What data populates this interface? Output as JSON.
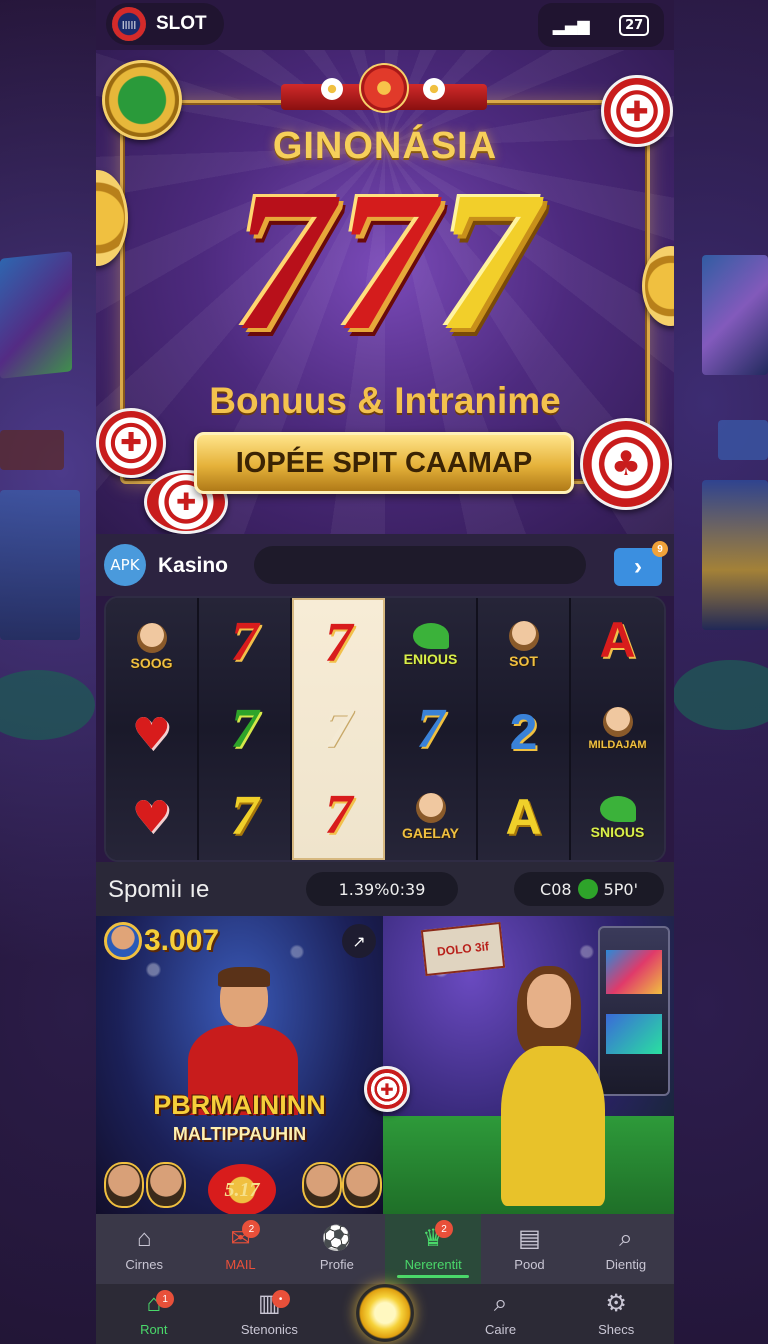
{
  "status_bar": {
    "app_label": "SLOT",
    "signal": "▂▄▆",
    "battery": "27"
  },
  "hero": {
    "title": "GINONÁSIA",
    "sevens": [
      "7",
      "7",
      "7"
    ],
    "subtitle": "Bonuus & Intranime",
    "cta_label": "IOPÉE SPIT CAAMAP"
  },
  "search": {
    "badge": "APK",
    "label": "Kasino",
    "placeholder": "",
    "go_icon": "chevron-right-icon",
    "go_badge": "9"
  },
  "reels": [
    [
      {
        "kind": "badge",
        "text": "SOOG"
      },
      {
        "kind": "heart"
      },
      {
        "kind": "heart"
      }
    ],
    [
      {
        "kind": "seven",
        "color": "red"
      },
      {
        "kind": "seven",
        "color": "green"
      },
      {
        "kind": "seven",
        "color": "yellow"
      }
    ],
    [
      {
        "kind": "seven",
        "color": "red"
      },
      {
        "kind": "seven",
        "color": "white"
      },
      {
        "kind": "seven",
        "color": "red"
      }
    ],
    [
      {
        "kind": "badge",
        "text": "ENIOUS"
      },
      {
        "kind": "seven",
        "color": "blue"
      },
      {
        "kind": "badge",
        "text": "GAELAY"
      }
    ],
    [
      {
        "kind": "badge",
        "text": "SOT"
      },
      {
        "kind": "letter",
        "text": "2",
        "color": "blue"
      },
      {
        "kind": "letter",
        "text": "A",
        "color": "yellow"
      }
    ],
    [
      {
        "kind": "letter",
        "text": "A",
        "color": "red"
      },
      {
        "kind": "badge",
        "text": "MILDAJAM"
      },
      {
        "kind": "badge",
        "text": "SNIOUS"
      }
    ]
  ],
  "info_row": {
    "title": "Spomiı ıe",
    "timer": "1.39%0:39",
    "counter_left": "C08",
    "counter_right": "5P0'"
  },
  "promos": [
    {
      "score": "3.007",
      "title": "PBRMAININN",
      "subtitle": "MALTIPPAUHIN",
      "jackpot": "5.17"
    },
    {
      "ticket": "DOLO 3if"
    }
  ],
  "nav_top": [
    {
      "icon": "home-icon",
      "label": "Cirnes",
      "state": "normal"
    },
    {
      "icon": "mail-icon",
      "label": "MAIL",
      "state": "red",
      "badge": "2"
    },
    {
      "icon": "soccer-icon",
      "label": "Profie",
      "state": "normal"
    },
    {
      "icon": "trophy-icon",
      "label": "Nererentit",
      "state": "green",
      "badge": "2"
    },
    {
      "icon": "document-icon",
      "label": "Pood",
      "state": "normal"
    },
    {
      "icon": "search-icon",
      "label": "Dientig",
      "state": "normal"
    }
  ],
  "nav_bottom": [
    {
      "icon": "home-icon",
      "label": "Ront",
      "state": "home",
      "badge": "1"
    },
    {
      "icon": "chart-icon",
      "label": "Stenonics",
      "state": "normal",
      "badge": "•"
    },
    {
      "icon": "spin-coin-icon",
      "label": "",
      "state": "center"
    },
    {
      "icon": "search-icon",
      "label": "Caire",
      "state": "normal"
    },
    {
      "icon": "gear-icon",
      "label": "Shecs",
      "state": "normal"
    }
  ]
}
